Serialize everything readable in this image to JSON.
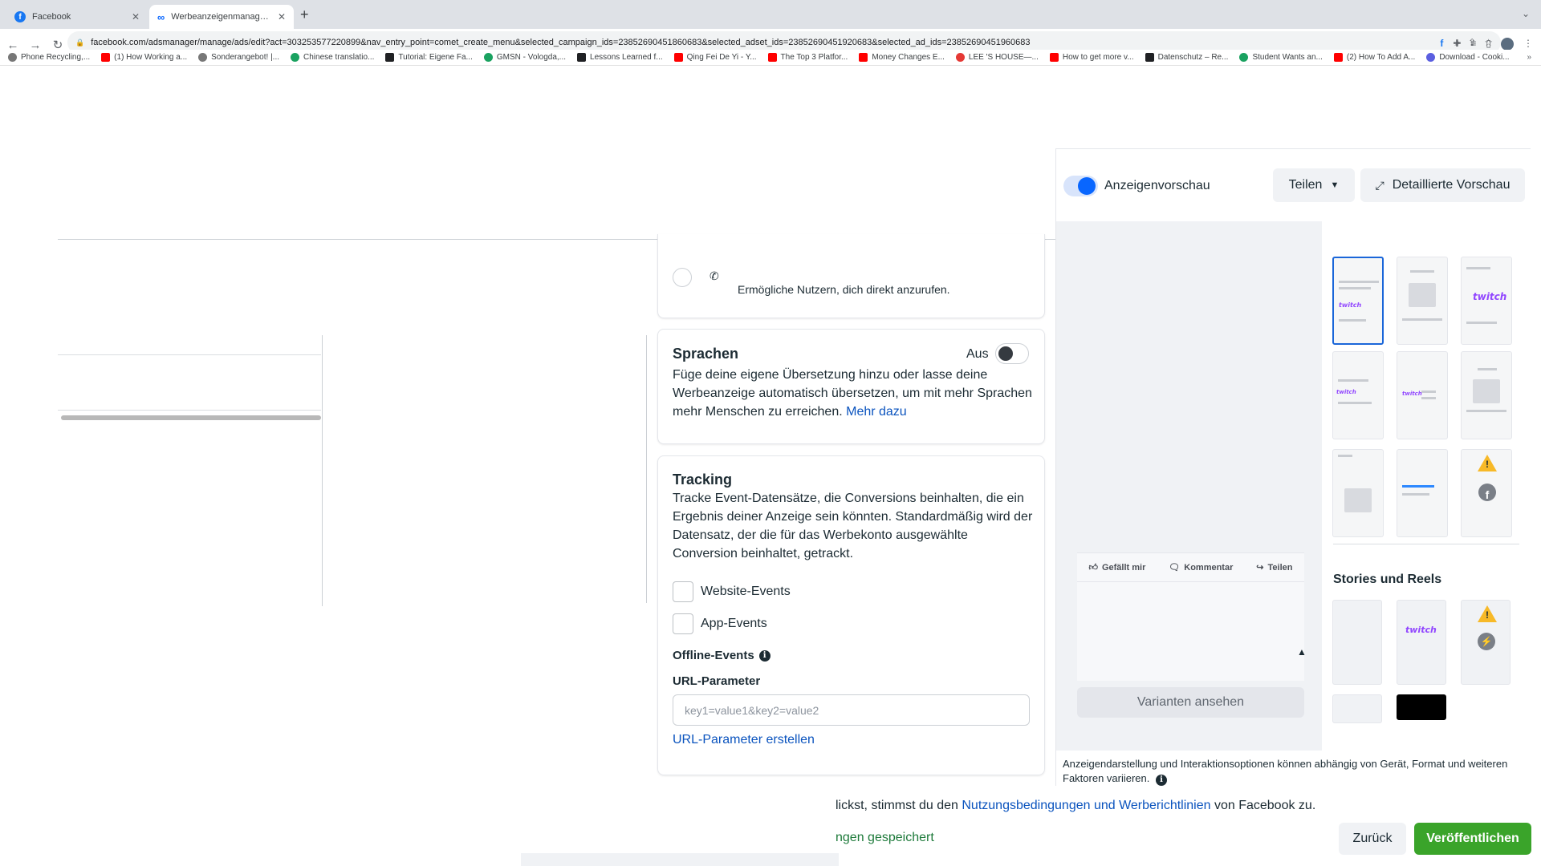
{
  "browser": {
    "tabs": [
      {
        "title": "Facebook",
        "favicon": "facebook-icon"
      },
      {
        "title": "Werbeanzeigenmanager - Wer...",
        "favicon": "meta-icon"
      }
    ],
    "url": "facebook.com/adsmanager/manage/ads/edit?act=303253577220899&nav_entry_point=comet_create_menu&selected_campaign_ids=23852690451860683&selected_adset_ids=23852690451920683&selected_ad_ids=23852690451960683",
    "bookmarks": [
      "Phone Recycling,...",
      "(1) How Working a...",
      "Sonderangebot! |...",
      "Chinese translatio...",
      "Tutorial: Eigene Fa...",
      "GMSN - Vologda,...",
      "Lessons Learned f...",
      "Qing Fei De Yi - Y...",
      "The Top 3 Platfor...",
      "Money Changes E...",
      "LEE 'S HOUSE—...",
      "How to get more v...",
      "Datenschutz – Re...",
      "Student Wants an...",
      "(2) How To Add A...",
      "Download - Cooki..."
    ]
  },
  "call_option": {
    "description": "Ermögliche Nutzern, dich direkt anzurufen."
  },
  "languages": {
    "title": "Sprachen",
    "status": "Aus",
    "body": "Füge deine eigene Übersetzung hinzu oder lasse deine Werbeanzeige automatisch übersetzen, um mit mehr Sprachen mehr Menschen zu erreichen.",
    "link": "Mehr dazu"
  },
  "tracking": {
    "title": "Tracking",
    "body": "Tracke Event-Datensätze, die Conversions beinhalten, die ein Ergebnis deiner Anzeige sein könnten. Standardmäßig wird der Datensatz, der die für das Werbekonto ausgewählte Conversion beinhaltet, getrackt.",
    "website_events": "Website-Events",
    "app_events": "App-Events",
    "offline_events": "Offline-Events",
    "url_params_label": "URL-Parameter",
    "url_params_placeholder": "key1=value1&key2=value2",
    "url_params_create": "URL-Parameter erstellen"
  },
  "preview": {
    "toggle_label": "Anzeigenvorschau",
    "share_button": "Teilen",
    "detail_button": "Detaillierte Vorschau",
    "post_actions": {
      "like": "Gefällt mir",
      "comment": "Kommentar",
      "share": "Teilen"
    },
    "variants_button": "Varianten ansehen",
    "stories_title": "Stories und Reels",
    "thumb_brand": "twitch",
    "disclaimer": "Anzeigendarstellung und Interaktionsoptionen können abhängig von Gerät, Format und weiteren Faktoren variieren."
  },
  "footer": {
    "terms_prefix": "lickst, stimmst du den ",
    "terms_link": "Nutzungsbedingungen und Werberichtlinien",
    "terms_suffix": " von Facebook zu.",
    "saved_status": "ngen gespeichert",
    "back_button": "Zurück",
    "publish_button": "Veröffentlichen"
  },
  "colors": {
    "accent": "#0866ff",
    "publish": "#3aa42a",
    "link": "#0a53be"
  }
}
